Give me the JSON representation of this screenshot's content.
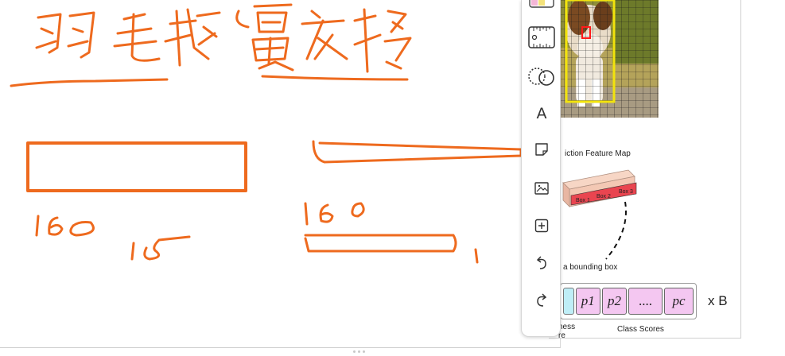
{
  "canvas": {
    "ink_color": "#ee6a1e",
    "handwritten_title": "羽毛球覆盖移",
    "numbers": [
      "160",
      "15",
      "160",
      "1"
    ]
  },
  "doc": {
    "caption_feature_map": "iction Feature Map",
    "caption_bounding_box": "a bounding box",
    "caption_objectness_line1": "ness",
    "caption_objectness_line2": "re",
    "caption_class_scores": "Class Scores",
    "box_labels": [
      "Box 1",
      "Box 2",
      "Box 3"
    ],
    "vector_cells": [
      "p1",
      "p2",
      "....",
      "pc"
    ],
    "multiplier_label": "x B"
  },
  "toolbar": {
    "tools": [
      "color-palette",
      "ruler",
      "lasso",
      "text",
      "sticky-note",
      "image",
      "add",
      "undo",
      "redo"
    ],
    "text_tool_glyph": "A"
  }
}
